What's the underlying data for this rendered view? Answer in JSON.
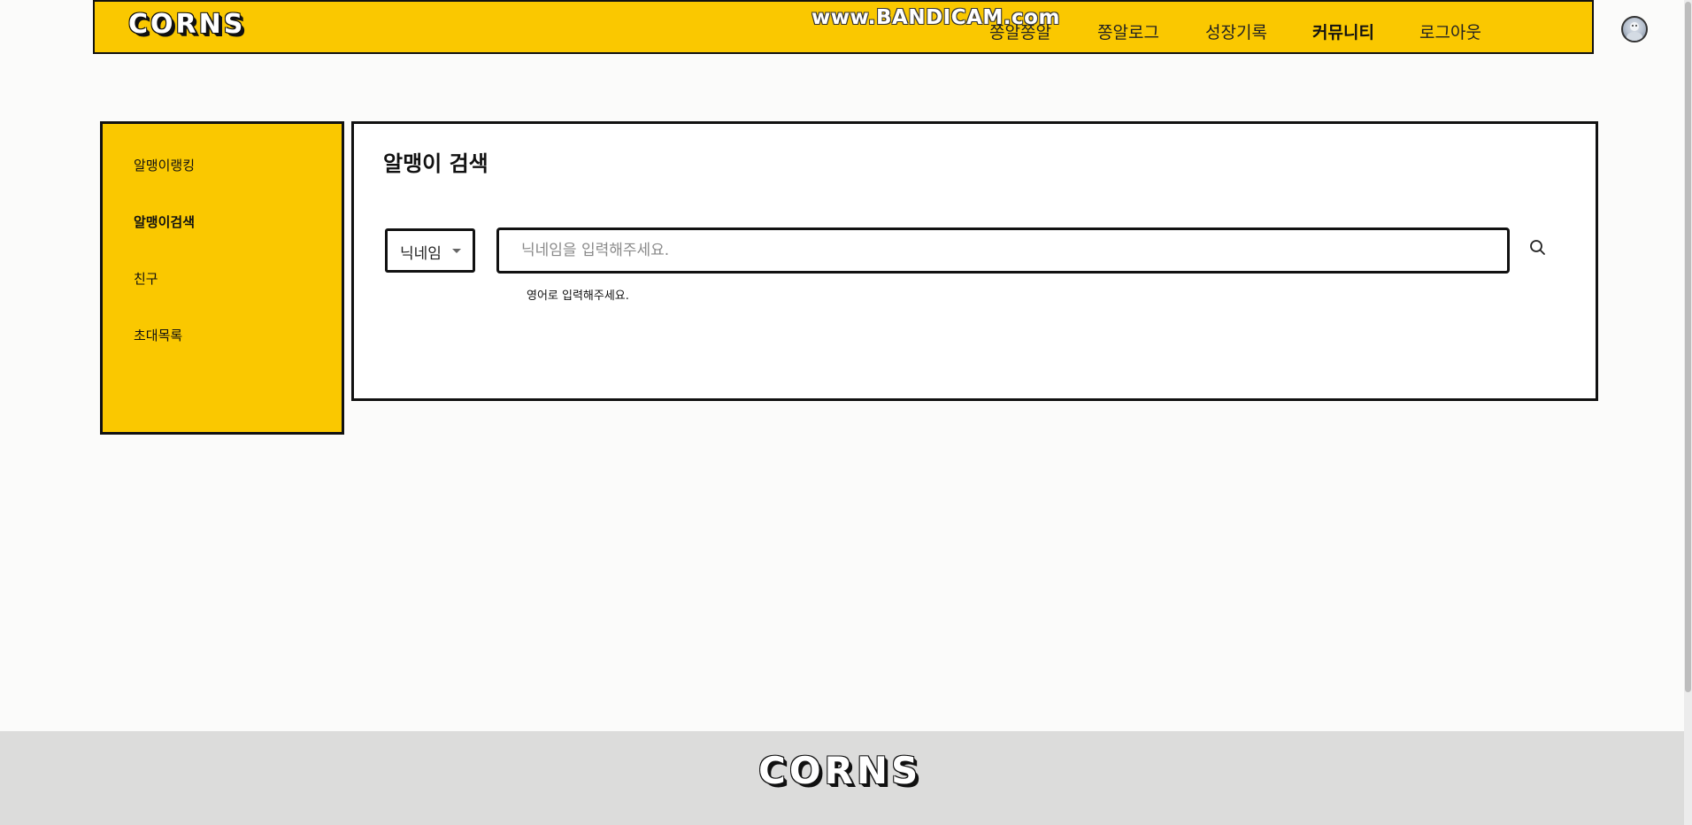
{
  "header": {
    "logo": "CORNS",
    "watermark": "www.BANDICAM.com",
    "nav": [
      "쫑알쫑알",
      "쫑알로그",
      "성장기록",
      "커뮤니티",
      "로그아웃"
    ],
    "active_nav": "커뮤니티"
  },
  "sidebar": {
    "items": [
      "알맹이랭킹",
      "알맹이검색",
      "친구",
      "초대목록"
    ],
    "active": "알맹이검색"
  },
  "main": {
    "title": "알맹이 검색",
    "search_type": "닉네임",
    "search_placeholder": "닉네임을 입력해주세요.",
    "hint": "영어로 입력해주세요."
  },
  "footer": {
    "logo": "CORNS"
  },
  "colors": {
    "brand_yellow": "#fac800",
    "border": "#111111",
    "footer_bg": "#dcdcdb"
  }
}
